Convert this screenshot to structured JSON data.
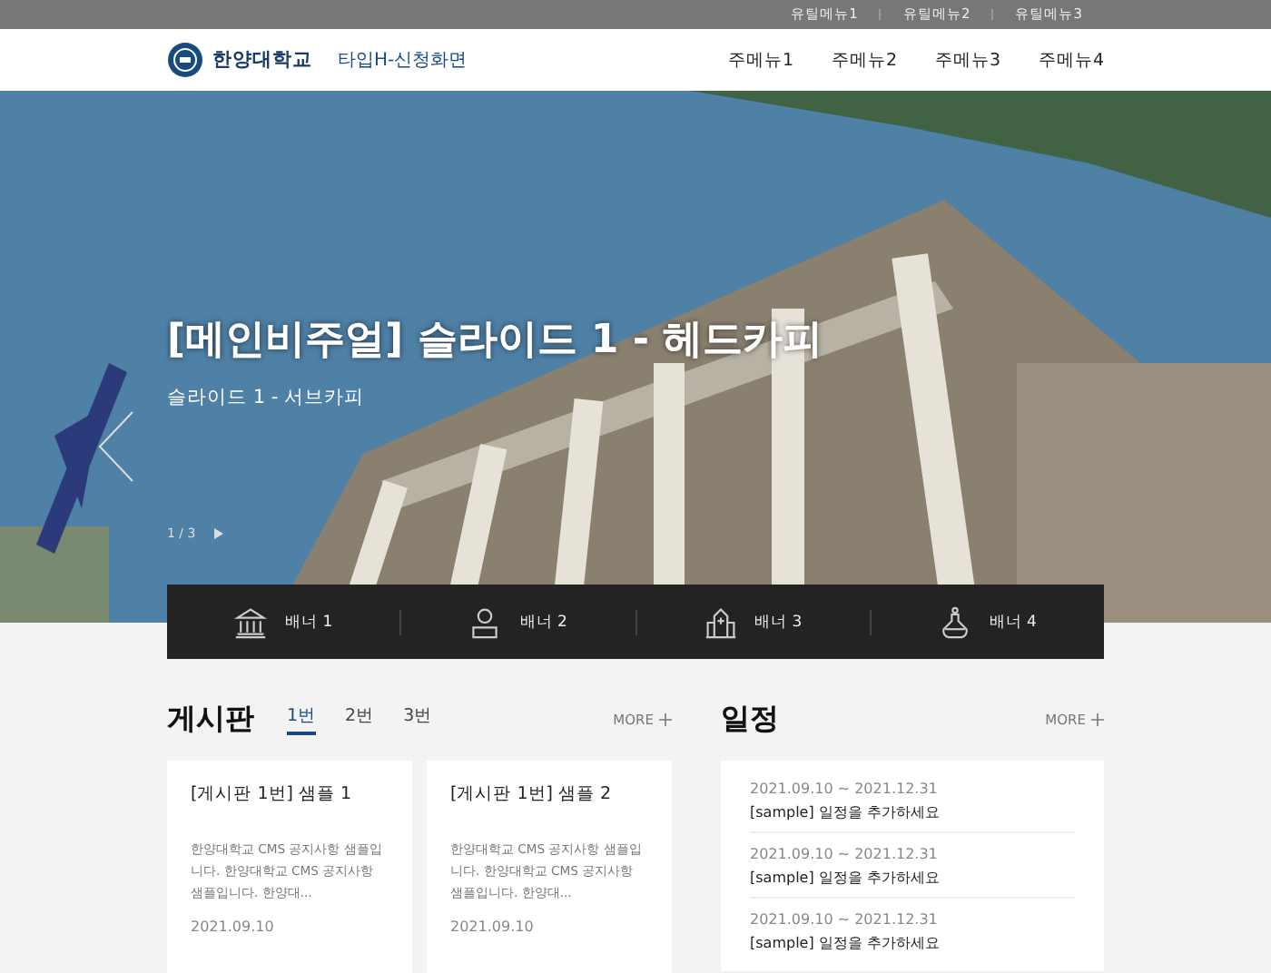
{
  "utility_menu": [
    "유틸메뉴1",
    "유틸메뉴2",
    "유틸메뉴3"
  ],
  "header": {
    "logo_text": "한양대학교",
    "subtitle": "타입H-신청화면",
    "main_menu": [
      "주메뉴1",
      "주메뉴2",
      "주메뉴3",
      "주메뉴4"
    ]
  },
  "hero": {
    "headline": "[메인비주얼] 슬라이드 1 - 헤드카피",
    "subcopy": "슬라이드 1 - 서브카피",
    "pager": "1 / 3"
  },
  "banners": [
    {
      "kind": "building",
      "label": "배너 1"
    },
    {
      "kind": "person",
      "label": "배너 2"
    },
    {
      "kind": "church",
      "label": "배너 3"
    },
    {
      "kind": "flask",
      "label": "배너 4"
    }
  ],
  "board": {
    "title": "게시판",
    "more": "MORE",
    "tabs": [
      {
        "label": "1번",
        "selected": true
      },
      {
        "label": "2번",
        "selected": false
      },
      {
        "label": "3번",
        "selected": false
      }
    ],
    "cards": [
      {
        "title": "[게시판 1번] 샘플 1",
        "text": "한양대학교 CMS 공지사항 샘플입니다. 한양대학교 CMS 공지사항 샘플입니다. 한양대...",
        "date": "2021.09.10"
      },
      {
        "title": "[게시판 1번] 샘플 2",
        "text": "한양대학교 CMS 공지사항 샘플입니다. 한양대학교 CMS 공지사항 샘플입니다. 한양대...",
        "date": "2021.09.10"
      }
    ]
  },
  "schedule": {
    "title": "일정",
    "more": "MORE",
    "items": [
      {
        "period": "2021.09.10 ~ 2021.12.31",
        "title": "[sample] 일정을 추가하세요"
      },
      {
        "period": "2021.09.10 ~ 2021.12.31",
        "title": "[sample] 일정을 추가하세요"
      },
      {
        "period": "2021.09.10 ~ 2021.12.31",
        "title": "[sample] 일정을 추가하세요"
      }
    ]
  }
}
